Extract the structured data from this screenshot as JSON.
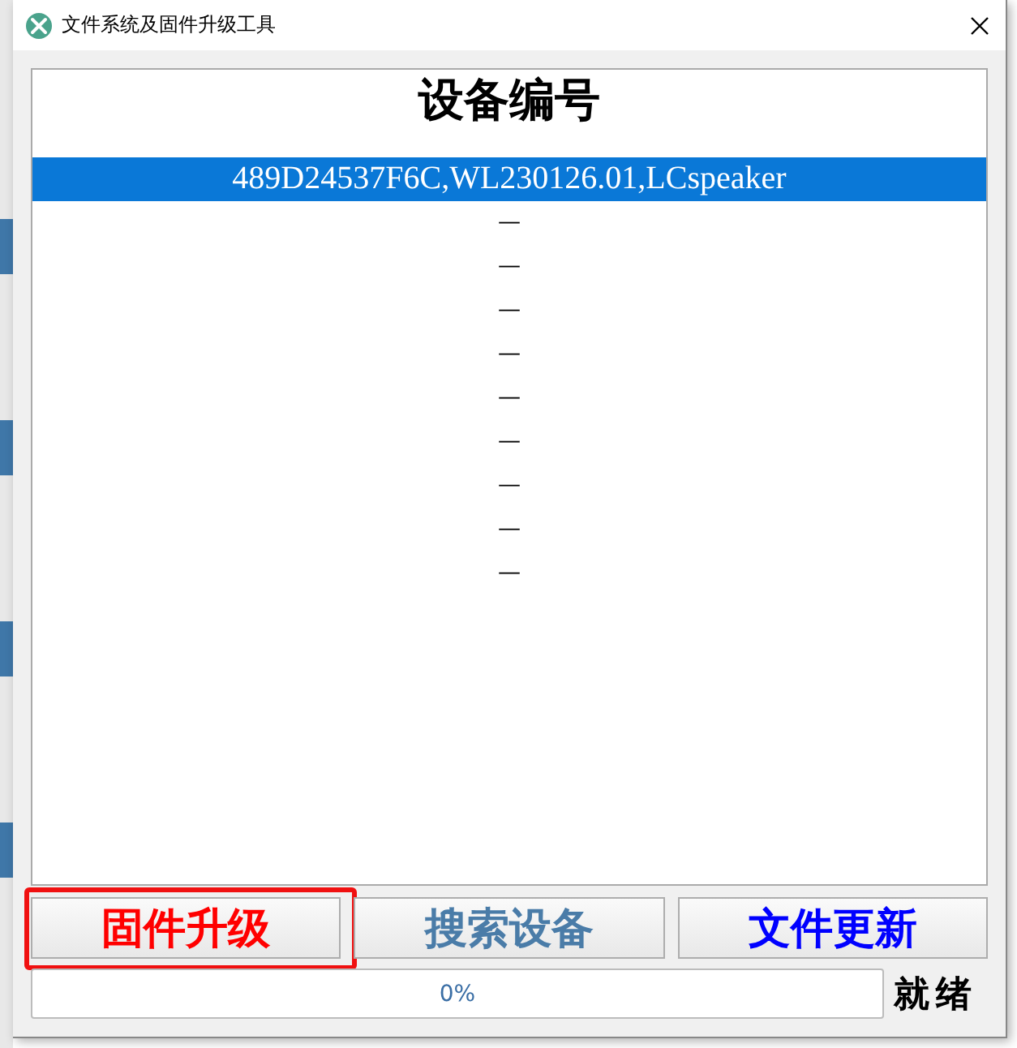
{
  "window": {
    "title": "文件系统及固件升级工具"
  },
  "device_list": {
    "heading": "设备编号",
    "rows": [
      {
        "text": "489D24537F6C,WL230126.01,LCspeaker",
        "selected": true
      },
      {
        "text": "—",
        "selected": false
      },
      {
        "text": "—",
        "selected": false
      },
      {
        "text": "—",
        "selected": false
      },
      {
        "text": "—",
        "selected": false
      },
      {
        "text": "—",
        "selected": false
      },
      {
        "text": "—",
        "selected": false
      },
      {
        "text": "—",
        "selected": false
      },
      {
        "text": "—",
        "selected": false
      },
      {
        "text": "—",
        "selected": false
      }
    ]
  },
  "buttons": [
    {
      "label": "固件升级",
      "color": "#ff0000",
      "highlighted": true
    },
    {
      "label": "搜索设备",
      "color": "#4a7ca8",
      "highlighted": false
    },
    {
      "label": "文件更新",
      "color": "#0000ff",
      "highlighted": false
    }
  ],
  "progress": {
    "level": 0,
    "text": "0%"
  },
  "status": "就绪"
}
